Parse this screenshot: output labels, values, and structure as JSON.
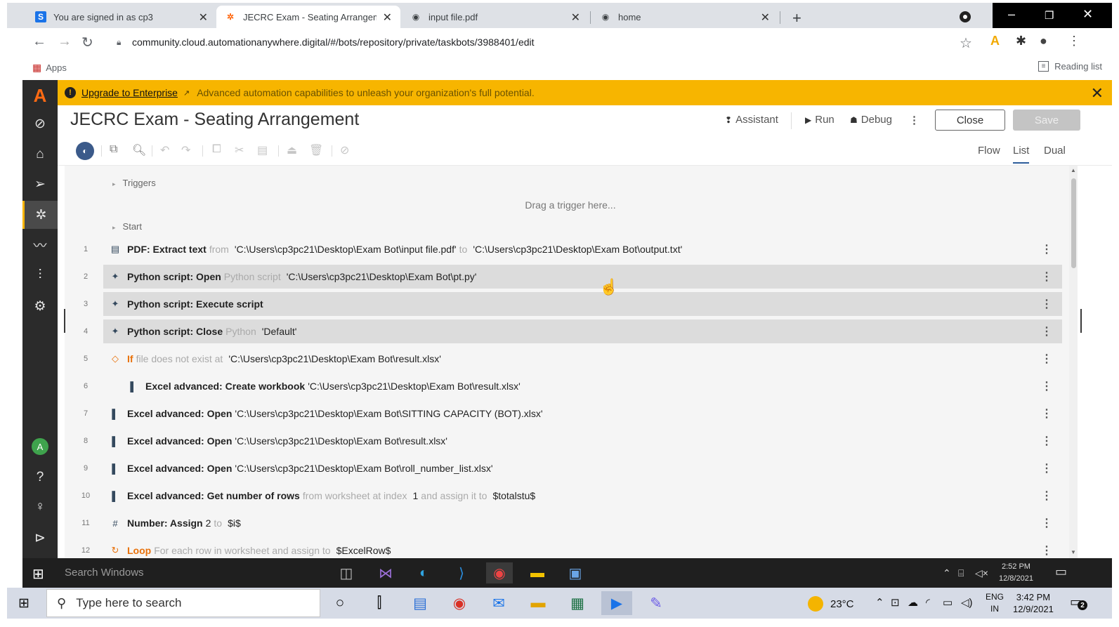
{
  "browser": {
    "tabs": [
      {
        "title": "You are signed in as cp3",
        "icon": "signin-icon"
      },
      {
        "title": "JECRC Exam - Seating Arrangem",
        "icon": "automation-anywhere-icon"
      },
      {
        "title": "input file.pdf",
        "icon": "globe-icon"
      },
      {
        "title": "home",
        "icon": "globe-icon"
      }
    ],
    "url": "community.cloud.automationanywhere.digital/#/bots/repository/private/taskbots/3988401/edit",
    "bookmarks": {
      "apps_label": "Apps",
      "reading_list_label": "Reading list"
    }
  },
  "banner": {
    "link_text": "Upgrade to Enterprise",
    "message": "Advanced automation capabilities to unleash your organization's full potential."
  },
  "bot": {
    "title": "JECRC Exam - Seating Arrangement",
    "assistant_label": "Assistant",
    "run_label": "Run",
    "debug_label": "Debug",
    "close_label": "Close",
    "save_label": "Save"
  },
  "view_tabs": [
    "Flow",
    "List",
    "Dual"
  ],
  "active_view": "List",
  "list": {
    "triggers_label": "Triggers",
    "drag_hint": "Drag a trigger here...",
    "start_label": "Start",
    "actions": [
      {
        "num": "1",
        "icon": "pdf-icon",
        "main": "PDF: Extract text",
        "parts": [
          {
            "t": "from",
            "k": "dim"
          },
          {
            "t": "'C:\\Users\\cp3pc21\\Desktop\\Exam Bot\\input file.pdf'",
            "k": "val"
          },
          {
            "t": "to",
            "k": "dim"
          },
          {
            "t": "'C:\\Users\\cp3pc21\\Desktop\\Exam Bot\\output.txt'",
            "k": "val"
          }
        ]
      },
      {
        "num": "2",
        "icon": "python-icon",
        "main": "Python script: Open",
        "parts": [
          {
            "t": "Python script",
            "k": "dim"
          },
          {
            "t": "'C:\\Users\\cp3pc21\\Desktop\\Exam Bot\\pt.py'",
            "k": "val"
          }
        ]
      },
      {
        "num": "3",
        "icon": "python-icon",
        "main": "Python script: Execute script",
        "parts": []
      },
      {
        "num": "4",
        "icon": "python-icon",
        "main": "Python script: Close",
        "parts": [
          {
            "t": "Python",
            "k": "dim"
          },
          {
            "t": "'Default'",
            "k": "val"
          }
        ]
      },
      {
        "num": "5",
        "icon": "if-icon",
        "main": "If",
        "parts": [
          {
            "t": "file does not exist at",
            "k": "dim"
          },
          {
            "t": "'C:\\Users\\cp3pc21\\Desktop\\Exam Bot\\result.xlsx'",
            "k": "val"
          }
        ]
      },
      {
        "num": "6",
        "icon": "excel-icon",
        "main": "Excel advanced: Create workbook",
        "parts": [
          {
            "t": "'C:\\Users\\cp3pc21\\Desktop\\Exam Bot\\result.xlsx'",
            "k": "val"
          }
        ]
      },
      {
        "num": "7",
        "icon": "excel-icon",
        "main": "Excel advanced: Open",
        "parts": [
          {
            "t": "'C:\\Users\\cp3pc21\\Desktop\\Exam Bot\\SITTING CAPACITY (BOT).xlsx'",
            "k": "val"
          }
        ]
      },
      {
        "num": "8",
        "icon": "excel-icon",
        "main": "Excel advanced: Open",
        "parts": [
          {
            "t": "'C:\\Users\\cp3pc21\\Desktop\\Exam Bot\\result.xlsx'",
            "k": "val"
          }
        ]
      },
      {
        "num": "9",
        "icon": "excel-icon",
        "main": "Excel advanced: Open",
        "parts": [
          {
            "t": "'C:\\Users\\cp3pc21\\Desktop\\Exam Bot\\roll_number_list.xlsx'",
            "k": "val"
          }
        ]
      },
      {
        "num": "10",
        "icon": "excel-icon",
        "main": "Excel advanced: Get number of rows",
        "parts": [
          {
            "t": "from worksheet at index",
            "k": "dim"
          },
          {
            "t": "1",
            "k": "val"
          },
          {
            "t": "and assign it to",
            "k": "dim"
          },
          {
            "t": "$totalstu$",
            "k": "val"
          }
        ]
      },
      {
        "num": "11",
        "icon": "number-icon",
        "main": "Number: Assign",
        "parts": [
          {
            "t": "2",
            "k": "val"
          },
          {
            "t": "to",
            "k": "dim"
          },
          {
            "t": "$i$",
            "k": "val"
          }
        ]
      },
      {
        "num": "12",
        "icon": "loop-icon",
        "main": "Loop",
        "parts": [
          {
            "t": "For each row in worksheet and assign to",
            "k": "dim"
          },
          {
            "t": "$ExcelRow$",
            "k": "val"
          }
        ]
      }
    ]
  },
  "inner_taskbar": {
    "search_placeholder": "Search Windows",
    "time": "2:52 PM",
    "date": "12/8/2021"
  },
  "host_taskbar": {
    "search_placeholder": "Type here to search",
    "temperature": "23°C",
    "lang_top": "ENG",
    "lang_bottom": "IN",
    "time": "3:42 PM",
    "date": "12/9/2021",
    "notification_count": "2"
  },
  "colors": {
    "banner": "#f7b500",
    "rail": "#2b2b2b",
    "accent": "#2c5c9a",
    "loop": "#e8710a"
  }
}
